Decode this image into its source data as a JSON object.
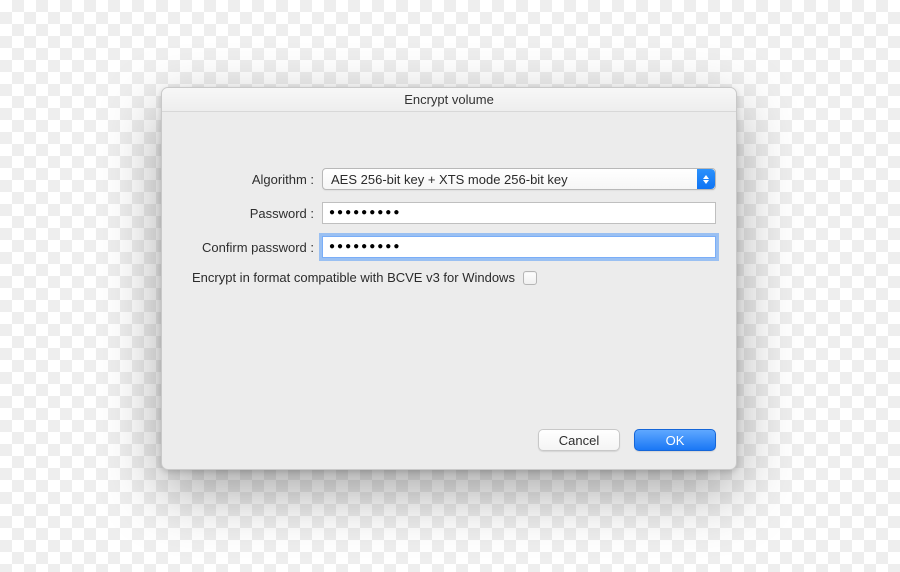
{
  "dialog": {
    "title": "Encrypt volume",
    "algorithm": {
      "label": "Algorithm :",
      "selected": "AES 256-bit key + XTS mode 256-bit key"
    },
    "password": {
      "label": "Password :",
      "value": "●●●●●●●●●"
    },
    "confirm": {
      "label": "Confirm password :",
      "value": "●●●●●●●●●"
    },
    "compat": {
      "label": "Encrypt in format compatible with BCVE v3 for Windows",
      "checked": false
    },
    "buttons": {
      "cancel": "Cancel",
      "ok": "OK"
    }
  }
}
